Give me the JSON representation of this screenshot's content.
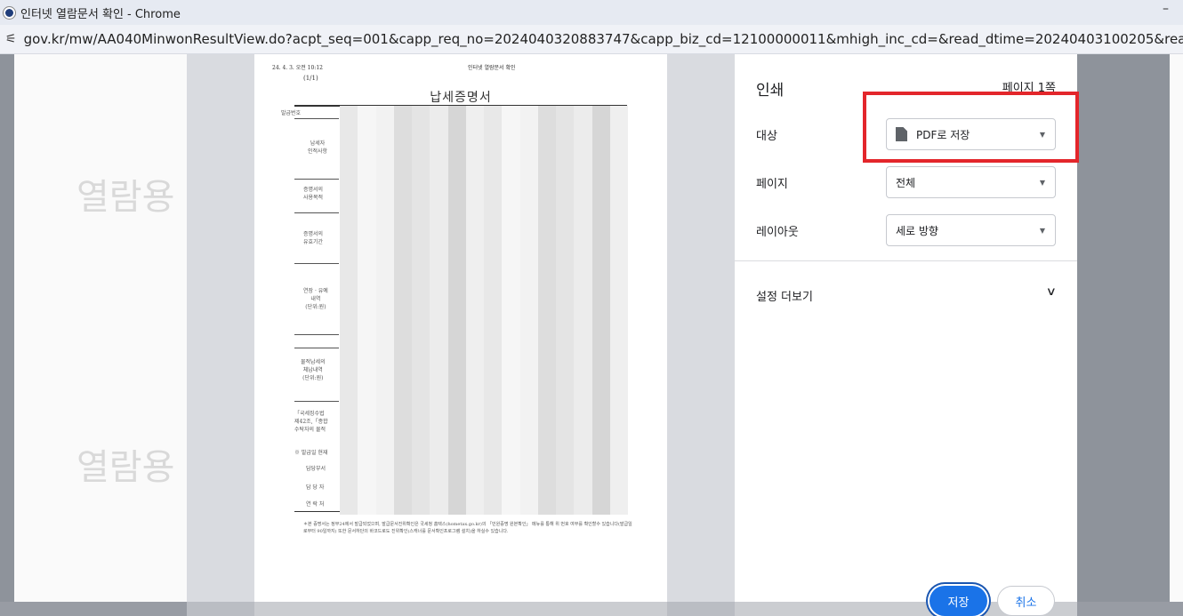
{
  "window": {
    "title": "인터넷 열람문서 확인 - Chrome",
    "minimize_glyph": "–"
  },
  "address_bar": {
    "url": "gov.kr/mw/AA040MinwonResultView.do?acpt_seq=001&capp_req_no=2024040320883747&capp_biz_cd=12100000011&mhigh_inc_cd=&read_dtime=20240403100205&read_end_dtime=20240504100205&",
    "icon": "tune-icon"
  },
  "watermark": {
    "text": "열람용"
  },
  "document": {
    "header_left": "24. 4. 3. 오전 10:12",
    "header_center": "인터넷 열람문서 확인",
    "page_indicator": "(1/1)",
    "title": "납세증명서",
    "labels": [
      "발급번호",
      "납세자\n인적사항",
      "증명서의\n사용목적",
      "증명서의\n유효기간",
      "연장 · 유예\n내역\n(단위:원)",
      "물적납세의\n체납내역\n(단위:원)",
      "「국세징수법\n제42조,「종합\n수탁자의 물적",
      "※ 발급일 현재",
      "담당부서",
      "담 당 자",
      "연 락 처"
    ],
    "footnote": "＊본 증명서는 정부24에서 발급되었으며, 발급문서진위확인은 국세청 홈택스(hometax.go.kr)의 「민원증명 원본확인」 메뉴를 통해 위 번호 여부를 확인할수 있습니다(발급일로부터 90일까지) 또한 문서하단의 바코드로도 진위확인(스캐너를 문서확인프로그램 설치)을 하실수 있습니다."
  },
  "print_dialog": {
    "title": "인쇄",
    "page_count": "페이지 1쪽",
    "destination_label": "대상",
    "destination_value": "PDF로 저장",
    "pages_label": "페이지",
    "pages_value": "전체",
    "layout_label": "레이아웃",
    "layout_value": "세로 방향",
    "more_settings": "설정 더보기",
    "save_button": "저장",
    "cancel_button": "취소"
  },
  "colors": {
    "accent": "#1a73e8",
    "highlight": "#e3262b"
  }
}
